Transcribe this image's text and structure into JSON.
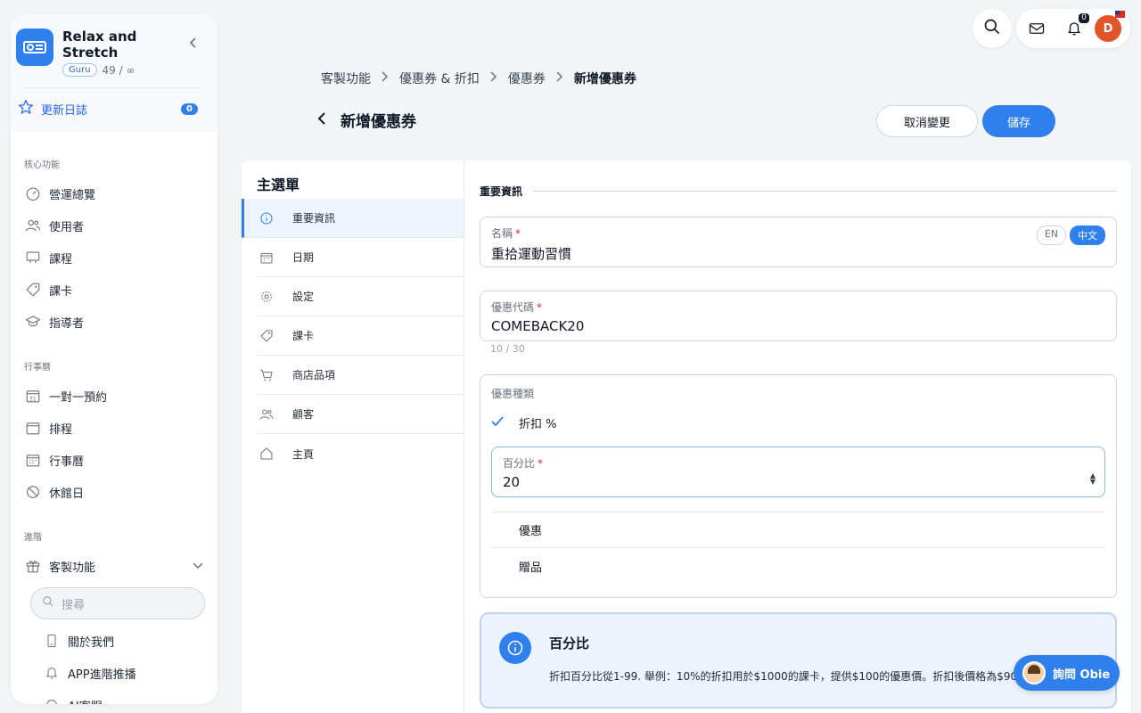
{
  "brand": {
    "name": "Relax and Stretch",
    "badge": "Guru",
    "meta": "49 / ∞"
  },
  "changelog": {
    "label": "更新日誌",
    "count": "0"
  },
  "sidebar": {
    "sections": [
      {
        "title": "核心功能",
        "items": [
          "營運總覽",
          "使用者",
          "課程",
          "課卡",
          "指導者"
        ]
      },
      {
        "title": "行事曆",
        "items": [
          "一對一預約",
          "排程",
          "行事曆",
          "休館日"
        ]
      },
      {
        "title": "進階",
        "items": [
          "客製功能"
        ]
      }
    ],
    "search_placeholder": "搜尋",
    "sub_items": [
      "關於我們",
      "APP進階推播",
      "AI客服"
    ]
  },
  "topbar": {
    "notif_count": "0",
    "avatar_initial": "D"
  },
  "breadcrumb": [
    "客製功能",
    "優惠券 & 折扣",
    "優惠券",
    "新增優惠券"
  ],
  "page": {
    "title": "新增優惠券",
    "cancel_label": "取消變更",
    "save_label": "儲存"
  },
  "menu": {
    "title": "主選單",
    "items": [
      "重要資訊",
      "日期",
      "設定",
      "課卡",
      "商店品項",
      "顧客",
      "主頁"
    ]
  },
  "form": {
    "section_label": "重要資訊",
    "name": {
      "label": "名稱",
      "value": "重拾運動習慣",
      "lang_en": "EN",
      "lang_zh": "中文"
    },
    "code": {
      "label": "優惠代碼",
      "value": "COMEBACK20",
      "hint": "10 / 30"
    },
    "type": {
      "label": "優惠種類",
      "selected": "折扣 %",
      "percent_label": "百分比",
      "percent_value": "20",
      "options": [
        "優惠",
        "贈品"
      ]
    },
    "info": {
      "title": "百分比",
      "body": "折扣百分比從1-99. 舉例：10%的折扣用於$1000的課卡，提供$100的優惠價。折扣後價格為$900。"
    }
  },
  "assistant": {
    "label": "詢問 Obie"
  },
  "colors": {
    "accent": "#2f80ed",
    "avatar": "#e2542a"
  }
}
